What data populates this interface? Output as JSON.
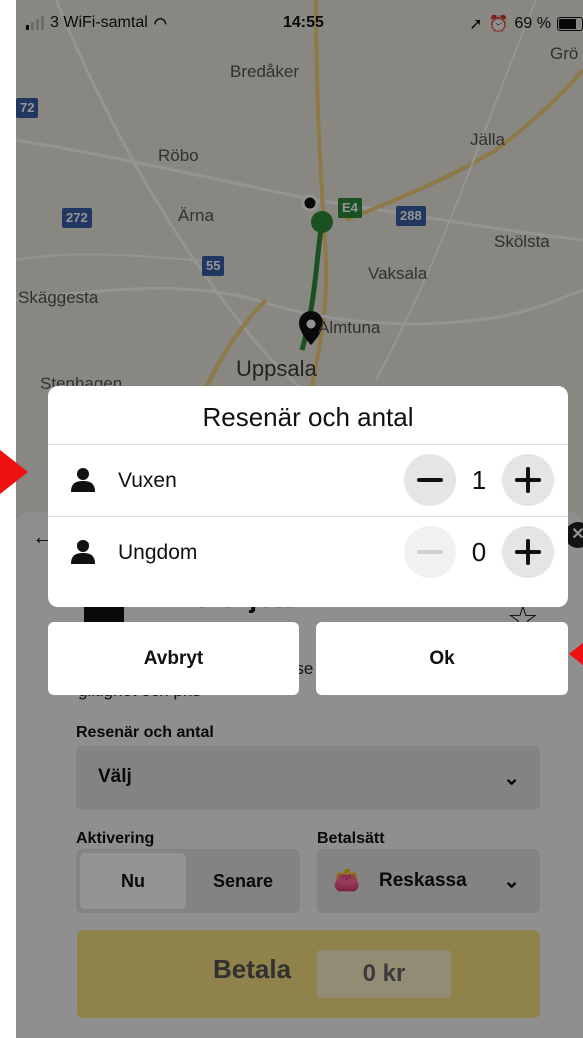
{
  "status_bar": {
    "carrier": "3 WiFi-samtal",
    "time": "14:55",
    "battery": "69 %",
    "battery_level": 0.69
  },
  "map": {
    "places": [
      "Bredåker",
      "Grö",
      "Röbo",
      "Jälla",
      "Ärna",
      "Skölsta",
      "Vaksala",
      "Skäggesta",
      "Almtuna",
      "Uppsala",
      "Stenhagen"
    ],
    "road_shields": [
      "72",
      "272",
      "E4",
      "288",
      "55"
    ],
    "route_color": "#2f8a3c"
  },
  "dialog": {
    "title": "Resenär och antal",
    "rows": [
      {
        "label": "Vuxen",
        "count": "1",
        "minus_enabled": true
      },
      {
        "label": "Ungdom",
        "count": "0",
        "minus_enabled": false
      }
    ],
    "cancel_label": "Avbryt",
    "ok_label": "Ok"
  },
  "sheet": {
    "ticket_title": "Enkelbiljett",
    "description": "Välj resenär och antal för att se biljettens giltighet och pris",
    "travelers_label": "Resenär och antal",
    "travelers_value": "Välj",
    "activation_label": "Aktivering",
    "activation_options": [
      "Nu",
      "Senare"
    ],
    "payment_label": "Betalsätt",
    "payment_value": "Reskassa",
    "pay_label": "Betala",
    "amount": "0 kr",
    "accent_color": "#f7e082"
  },
  "annotation_color": "#ee1111"
}
